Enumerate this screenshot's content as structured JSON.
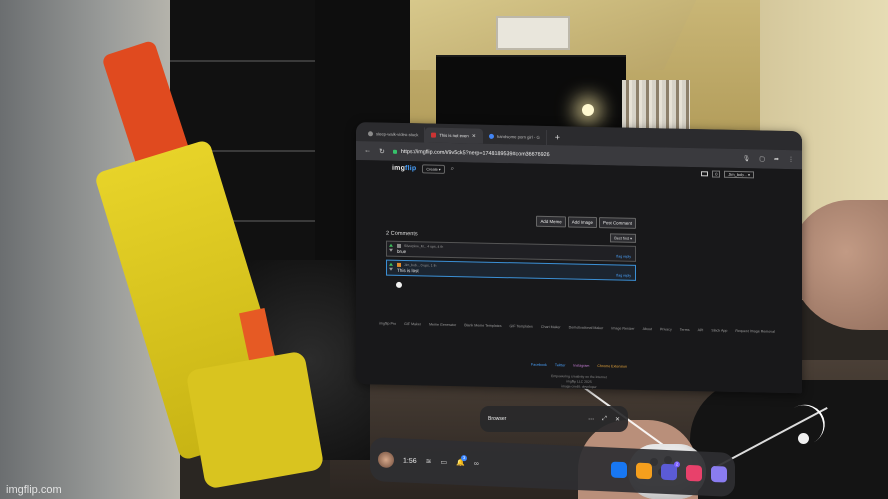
{
  "browser": {
    "tabs": [
      {
        "label": "sleep-walk-video-stuck",
        "active": false
      },
      {
        "label": "This is not even",
        "active": true
      },
      {
        "label": "handsome porn girl - G",
        "active": false
      }
    ],
    "url": "https://imgflip.com/i/9v5ck5?nerp=1748189539#com36676926"
  },
  "site": {
    "logo_prefix": "img",
    "logo_suffix": "flip",
    "create_label": "Create ▾",
    "notif_count": "0",
    "username": "Jim_bob... ▾",
    "buttons": [
      "Add Meme",
      "Add Image",
      "Post Comment"
    ],
    "comments_title": "2 Comments",
    "sort_label": "Best first ▾",
    "comments": [
      {
        "meta": "Silverpine_M... 4 ups, 4 th",
        "text": "brue",
        "reply": "flag reply",
        "highlighted": false
      },
      {
        "meta": "Jim_bob... 0 ups, 1 th",
        "text": "This is lost",
        "reply": "flag reply",
        "highlighted": true
      }
    ],
    "footer_links": [
      "imgflip Pro",
      "GIF Maker",
      "Meme Generator",
      "Blank Meme Templates",
      "GIF Templates",
      "Chart Maker",
      "Demotivational Maker",
      "Image Resizer",
      "About",
      "Privacy",
      "Terms",
      "API",
      "Slack App",
      "Request Image Removal"
    ],
    "footer_social": [
      "Facebook",
      "Twitter",
      "Instagram",
      "Chrome Extension"
    ],
    "footer_small": [
      "Empowering creativity on the internet",
      "imgflip LLC 2025",
      "image credit: developer"
    ]
  },
  "window_bar": {
    "title": "Browser"
  },
  "dock": {
    "time": "1:56",
    "notification_count": "3",
    "app_badge": "2"
  },
  "watermark": "imgflip.com",
  "colors": {
    "accent": "#3a86ff",
    "upvote": "#3cbd5b",
    "link": "#4aa3ff",
    "highlight_border": "#3b8fd4"
  }
}
